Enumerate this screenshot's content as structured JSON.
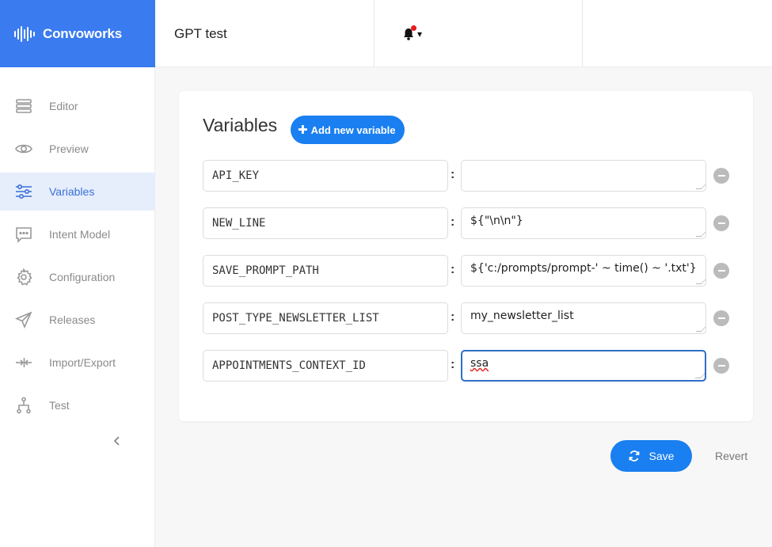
{
  "brand": {
    "name": "Convoworks",
    "icon": "waveform-logo"
  },
  "header": {
    "title": "GPT test",
    "notifications_caret": "▾"
  },
  "sidebar": {
    "items": [
      {
        "label": "Editor",
        "icon": "stack-icon",
        "active": false
      },
      {
        "label": "Preview",
        "icon": "eye-icon",
        "active": false
      },
      {
        "label": "Variables",
        "icon": "sliders-icon",
        "active": true
      },
      {
        "label": "Intent Model",
        "icon": "chat-icon",
        "active": false
      },
      {
        "label": "Configuration",
        "icon": "gear-icon",
        "active": false
      },
      {
        "label": "Releases",
        "icon": "send-icon",
        "active": false
      },
      {
        "label": "Import/Export",
        "icon": "arrows-icon",
        "active": false
      },
      {
        "label": "Test",
        "icon": "tree-icon",
        "active": false
      }
    ],
    "collapse_glyph": "‹"
  },
  "variables": {
    "title": "Variables",
    "add_button": {
      "icon": "plus-icon",
      "label": "Add new variable"
    },
    "separator": ":",
    "rows": [
      {
        "key": "API_KEY",
        "value": ""
      },
      {
        "key": "NEW_LINE",
        "value": "${\"\\n\\n\"}"
      },
      {
        "key": "SAVE_PROMPT_PATH",
        "value": "${'c:/prompts/prompt-' ~ time() ~ '.txt'}"
      },
      {
        "key": "POST_TYPE_NEWSLETTER_LIST",
        "value": "my_newsletter_list"
      },
      {
        "key": "APPOINTMENTS_CONTEXT_ID",
        "value": "ssa"
      }
    ]
  },
  "actions": {
    "save_label": "Save",
    "revert_label": "Revert"
  },
  "colors": {
    "primary": "#1a7ff0",
    "brand_bg": "#3a7bef",
    "active_nav_bg": "#e6eefc",
    "notification_dot": "#e51c1c"
  }
}
